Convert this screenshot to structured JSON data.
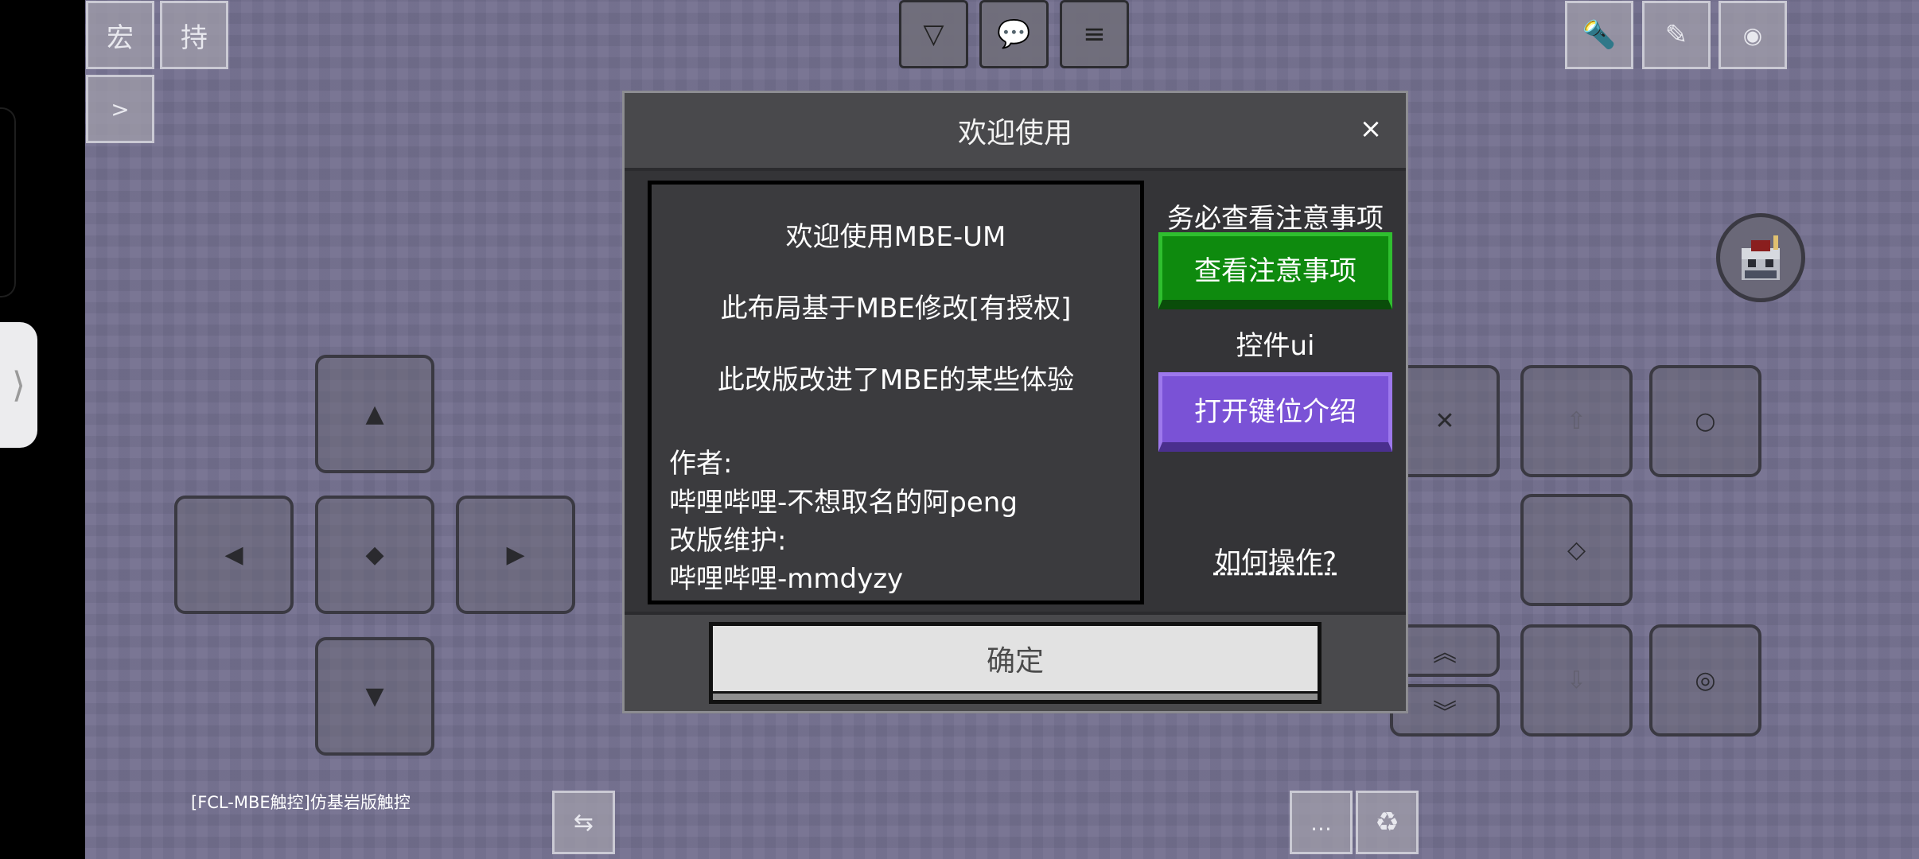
{
  "hud": {
    "macro_label": "宏",
    "hold_label": "持",
    "expand_label": ">",
    "inventory_label": "▽",
    "chat_label": "💬",
    "menu_label": "≡",
    "torch_label": "🔦",
    "edit_label": "✎",
    "record_label": "◉",
    "layout_name": "[FCL-MBE触控]仿基岩版触控",
    "swap_label": "⇆",
    "more_label": "...",
    "recycle_label": "♻"
  },
  "dpad": {
    "up": "▲",
    "down": "▼",
    "left": "◀",
    "right": "▶",
    "center": "◆"
  },
  "action_pad": {
    "close": "✕",
    "shift_up": "⇧",
    "circle": "○",
    "diamond": "◇",
    "fly_up": "︽",
    "fly_down": "︾",
    "shift_down": "⇩",
    "target": "◎"
  },
  "side_drawer_label": "⟩",
  "dialog": {
    "title": "欢迎使用",
    "close_label": "×",
    "lines": {
      "welcome": "欢迎使用MBE-UM",
      "based_on": "此布局基于MBE修改[有授权]",
      "improved": "此改版改进了MBE的某些体验",
      "author_label": "作者:",
      "author_name": "哔哩哔哩-不想取名的阿peng",
      "maintainer_label": "改版维护:",
      "maintainer_name": "哔哩哔哩-mmdyzy"
    },
    "notice_hint": "务必查看注意事项",
    "notice_button": "查看注意事项",
    "controls_label": "控件ui",
    "keys_button": "打开键位介绍",
    "howto_link": "如何操作?",
    "ok_button": "确定",
    "colors": {
      "green": "#0e8a0e",
      "purple": "#7a52d6"
    }
  }
}
